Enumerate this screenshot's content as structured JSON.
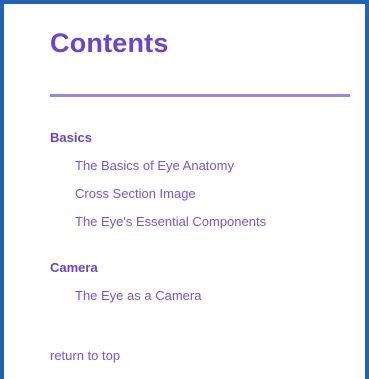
{
  "contents": {
    "title": "Contents",
    "sections": [
      {
        "heading": "Basics",
        "links": [
          "The Basics of Eye Anatomy",
          "Cross Section Image",
          "The Eye's Essential Components"
        ]
      },
      {
        "heading": "Camera",
        "links": [
          "The Eye as a Camera"
        ]
      }
    ],
    "return_label": "return to top"
  },
  "colors": {
    "frame_border": "#1f63b8",
    "title": "#6a42d4",
    "divider": "#9b84e3",
    "link": "#7a52de"
  }
}
